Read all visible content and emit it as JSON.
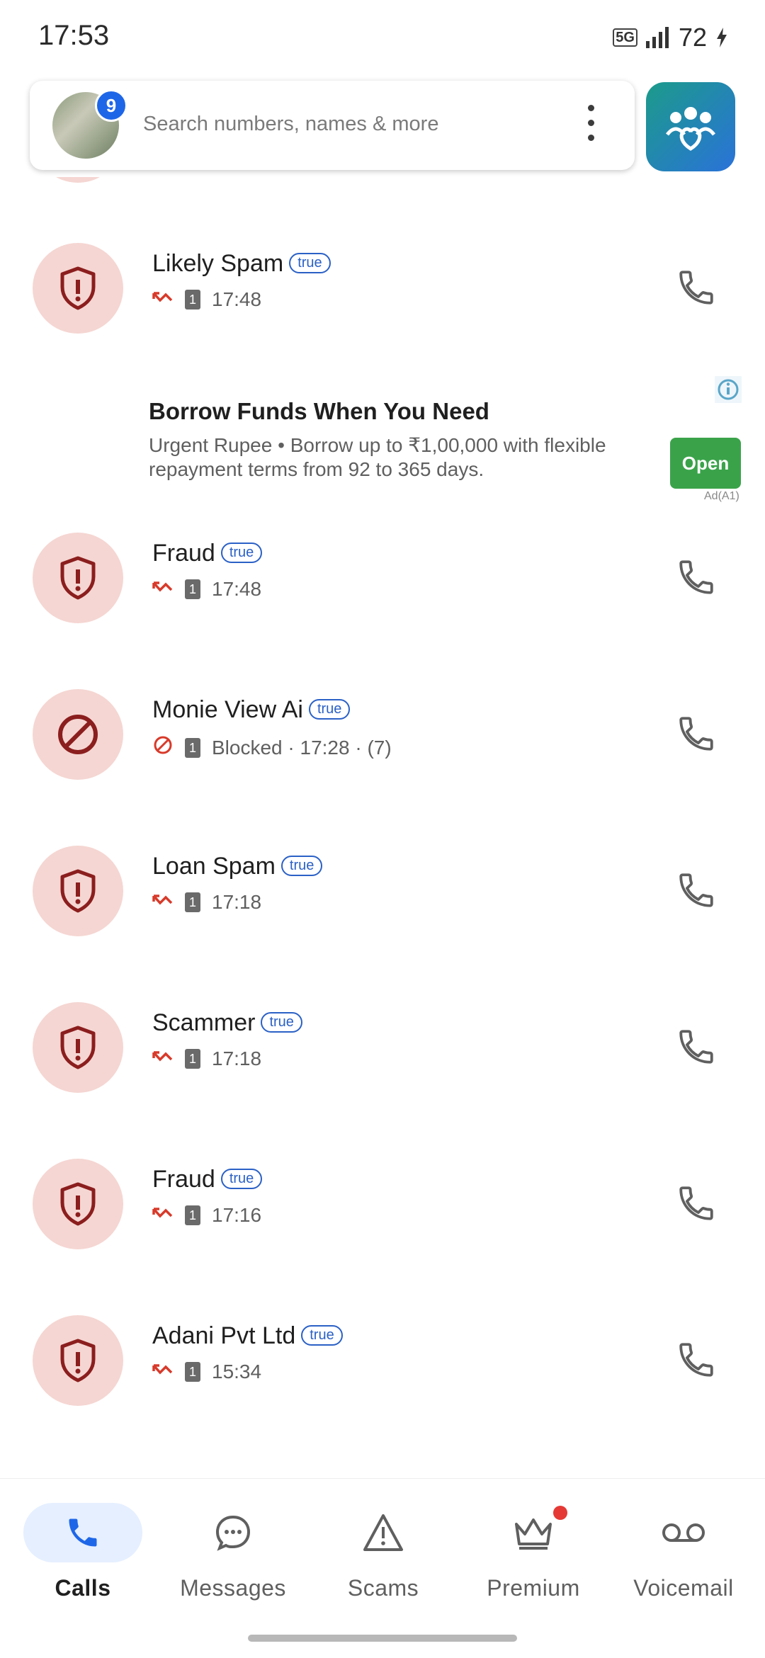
{
  "status_bar": {
    "time": "17:53",
    "network": "5G",
    "battery": "72"
  },
  "search": {
    "placeholder": "Search numbers, names & more",
    "avatar_badge": "9"
  },
  "calls": [
    {
      "name": "Likely Spam",
      "tag": "true",
      "icon": "shield-alert-icon",
      "status": "",
      "time": "17:48",
      "call_type": "missed-call-icon"
    },
    {
      "name": "Fraud",
      "tag": "true",
      "icon": "shield-alert-icon",
      "status": "",
      "time": "17:48",
      "call_type": "missed-call-icon"
    },
    {
      "name": "Monie View Ai",
      "tag": "true",
      "icon": "blocked-icon",
      "status": "Blocked · 17:28 · (7)",
      "time": "",
      "call_type": "blocked-icon"
    },
    {
      "name": "Loan Spam",
      "tag": "true",
      "icon": "shield-alert-icon",
      "status": "",
      "time": "17:18",
      "call_type": "missed-call-icon"
    },
    {
      "name": "Scammer",
      "tag": "true",
      "icon": "shield-alert-icon",
      "status": "",
      "time": "17:18",
      "call_type": "missed-call-icon"
    },
    {
      "name": "Fraud",
      "tag": "true",
      "icon": "shield-alert-icon",
      "status": "",
      "time": "17:16",
      "call_type": "missed-call-icon"
    },
    {
      "name": "Adani Pvt Ltd",
      "tag": "true",
      "icon": "shield-alert-icon",
      "status": "",
      "time": "15:34",
      "call_type": "missed-call-icon"
    }
  ],
  "sim_label": "1",
  "ad": {
    "title": "Borrow Funds When You Need",
    "body": "Urgent Rupee • Borrow up to ₹1,00,000 with flexible repayment terms from 92 to 365 days.",
    "button": "Open",
    "label": "Ad(A1)"
  },
  "nav": [
    {
      "label": "Calls",
      "icon": "phone-icon",
      "active": true
    },
    {
      "label": "Messages",
      "icon": "message-icon",
      "active": false
    },
    {
      "label": "Scams",
      "icon": "warning-icon",
      "active": false
    },
    {
      "label": "Premium",
      "icon": "crown-icon",
      "active": false
    },
    {
      "label": "Voicemail",
      "icon": "voicemail-icon",
      "active": false
    }
  ],
  "colors": {
    "accent": "#1e66e8",
    "spam_bg": "#f5d6d2",
    "spam_icon": "#8b1e1e",
    "missed": "#d83a2a",
    "ad_button": "#3aa34a"
  }
}
